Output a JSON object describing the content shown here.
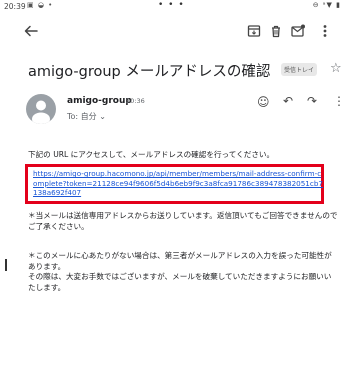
{
  "status_bar": {
    "time": "20:39",
    "left_icons": "▣ ◒ •",
    "center_dots": "• • •",
    "right_icons": "⊖ ᵃ▼ ▮"
  },
  "toolbar": {
    "back_icon": "arrow-back-icon",
    "archive_icon": "archive-icon",
    "delete_icon": "trash-icon",
    "mark_unread_icon": "mail-icon",
    "more_icon": "more-vert-icon"
  },
  "email": {
    "subject": "amigo-group メールアドレスの確認",
    "label": "受信トレイ",
    "sender_name": "amigo-group",
    "time": "20:36",
    "recipient": "To: 自分 ⌄",
    "intro": "下記の URL にアクセスして、メールアドレスの確認を行ってください。",
    "link": "https://amigo-group.hacomono.jp/api/member/members/mail-address-confirm-complete?token=21128ce94f9606f5d4b6eb9f9c3a8fca91786c38947838205​1cb7138a692f407",
    "note1": "＊当メールは送信専用アドレスからお送りしています。返信頂いてもご回答できませんのでご了承ください。",
    "note2": "＊このメールに心あたりがない場合は、第三者がメールアドレスの入力を誤った可能性があります。\nその際は、大変お手数ではございますが、メールを破棄していただきますようにお願いいたします。"
  },
  "colors": {
    "link": "#1a56d6",
    "highlight_border": "#e3001b",
    "avatar": "#9aa0a6"
  }
}
